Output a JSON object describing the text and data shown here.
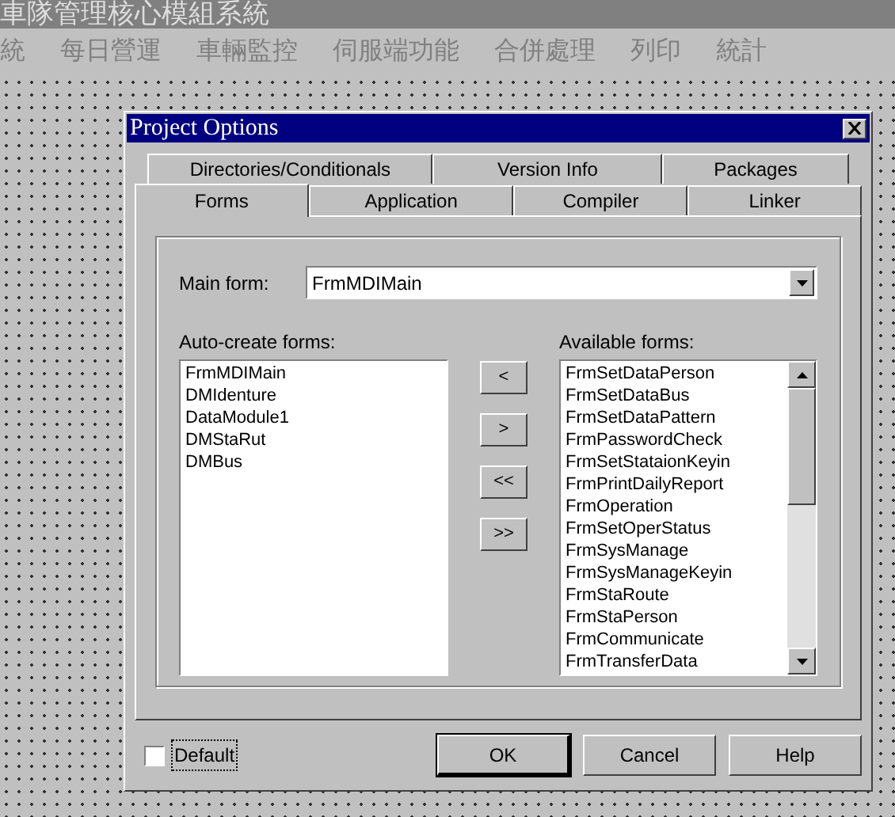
{
  "app": {
    "title": "車隊管理核心模組系統",
    "menu": [
      "統",
      "每日營運",
      "車輛監控",
      "伺服端功能",
      "合併處理",
      "列印",
      "統計"
    ]
  },
  "dialog": {
    "title": "Project Options",
    "tab_rows": [
      [
        {
          "label": "Directories/Conditionals",
          "selected": false
        },
        {
          "label": "Version Info",
          "selected": false
        },
        {
          "label": "Packages",
          "selected": false
        }
      ],
      [
        {
          "label": "Forms",
          "selected": true
        },
        {
          "label": "Application",
          "selected": false
        },
        {
          "label": "Compiler",
          "selected": false
        },
        {
          "label": "Linker",
          "selected": false
        }
      ]
    ],
    "main_form": {
      "label": "Main form:",
      "value": "FrmMDIMain"
    },
    "auto_create": {
      "label": "Auto-create forms:",
      "items": [
        "FrmMDIMain",
        "DMIdenture",
        "DataModule1",
        "DMStaRut",
        "DMBus"
      ]
    },
    "move_buttons": [
      "<",
      ">",
      "<<",
      ">>"
    ],
    "available": {
      "label": "Available forms:",
      "items": [
        "FrmSetDataPerson",
        "FrmSetDataBus",
        "FrmSetDataPattern",
        "FrmPasswordCheck",
        "FrmSetStataionKeyin",
        "FrmPrintDailyReport",
        "FrmOperation",
        "FrmSetOperStatus",
        "FrmSysManage",
        "FrmSysManageKeyin",
        "FrmStaRoute",
        "FrmStaPerson",
        "FrmCommunicate",
        "FrmTransferData"
      ]
    },
    "default": {
      "label": "Default",
      "checked": false
    },
    "buttons": [
      {
        "label": "OK",
        "kind": "default"
      },
      {
        "label": "Cancel",
        "kind": "normal"
      },
      {
        "label": "Help",
        "kind": "normal"
      }
    ]
  }
}
